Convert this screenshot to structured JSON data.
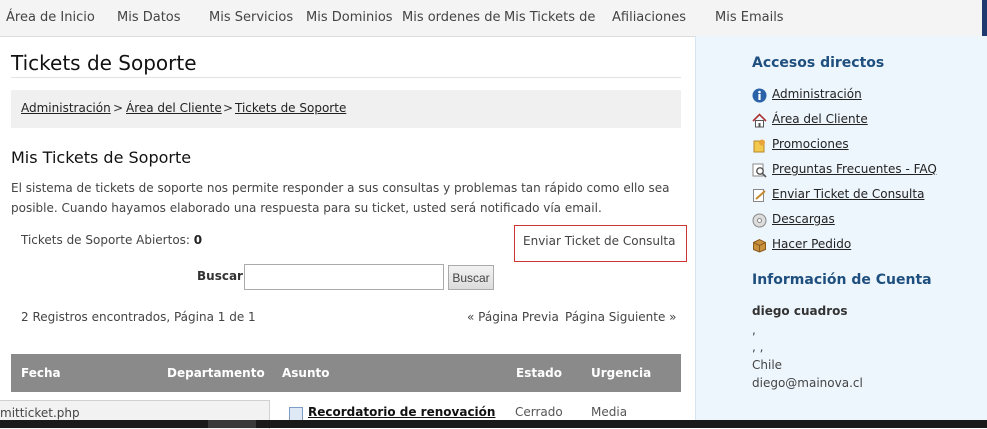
{
  "topnav": {
    "items": [
      "Área de Inicio",
      "Mis Datos",
      "Mis Servicios",
      "Mis Dominios",
      "Mis ordenes de",
      "Mis Tickets de",
      "Afiliaciones",
      "Mis Emails"
    ]
  },
  "main": {
    "title": "Tickets de Soporte",
    "breadcrumb": [
      "Administración",
      "Área del Cliente",
      "Tickets de Soporte"
    ],
    "breadcrumb_sep": ">",
    "section_title": "Mis Tickets de Soporte",
    "intro": "El sistema de tickets de soporte nos permite responder a sus consultas y problemas tan rápido como ello sea posible. Cuando hayamos elaborado una respuesta para su ticket, usted será notificado vía email.",
    "open_tickets_label": "Tickets de Soporte Abiertos:",
    "open_tickets_count": "0",
    "send_ticket_label": "Enviar Ticket de Consulta",
    "search_label": "Buscar:",
    "search_value": "",
    "search_button": "Buscar",
    "records_text": "2 Registros encontrados, Página 1 de 1",
    "prev_page": "« Página Previa",
    "next_page": "Página Siguiente »",
    "table": {
      "headers": [
        "Fecha",
        "Departamento",
        "Asunto",
        "Estado",
        "Urgencia"
      ],
      "rows": [
        {
          "subject": "Recordatorio de renovación",
          "status": "Cerrado",
          "urgency": "Media"
        }
      ]
    }
  },
  "statusbar": {
    "url": "mitticket.php"
  },
  "sidebar": {
    "shortcuts_title": "Accesos directos",
    "links": [
      {
        "label": "Administración",
        "icon": "info-icon"
      },
      {
        "label": "Área del Cliente",
        "icon": "home-icon"
      },
      {
        "label": "Promociones",
        "icon": "promo-icon"
      },
      {
        "label": "Preguntas Frecuentes - FAQ",
        "icon": "magnifier-icon"
      },
      {
        "label": "Enviar Ticket de Consulta",
        "icon": "edit-icon"
      },
      {
        "label": "Descargas",
        "icon": "disc-icon"
      },
      {
        "label": "Hacer Pedido",
        "icon": "box-icon"
      }
    ],
    "account_title": "Información de Cuenta",
    "account": {
      "name": "diego cuadros",
      "line1": ",",
      "line2": ", ,",
      "country": "Chile",
      "email": "diego@mainova.cl"
    }
  },
  "colors": {
    "sidebar_title": "#1e4f7e",
    "table_header": "#8a8a8a",
    "highlight_border": "#cc3333"
  }
}
